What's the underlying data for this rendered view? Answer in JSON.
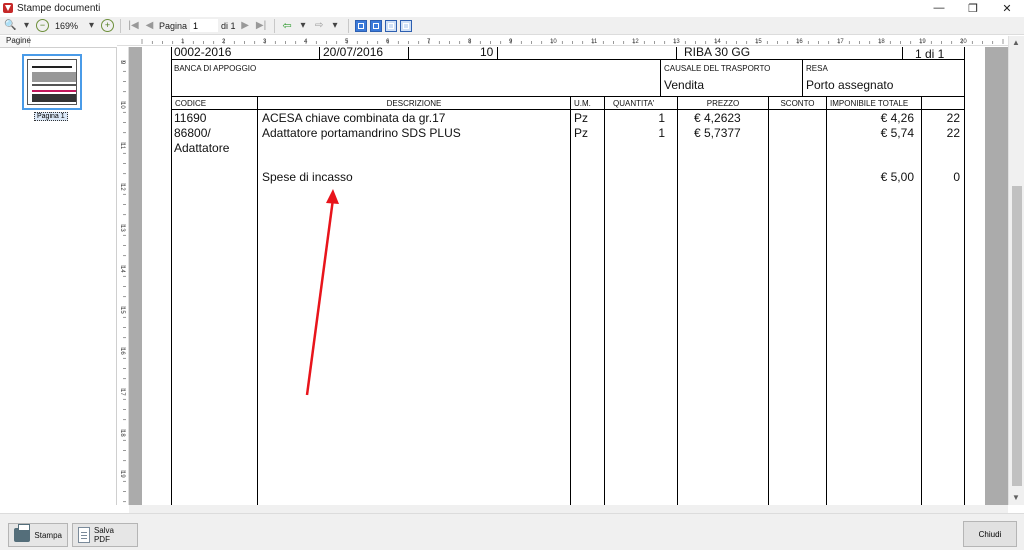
{
  "window": {
    "title": "Stampe documenti",
    "controls": {
      "minimize": "—",
      "restore": "❐",
      "close": "✕"
    }
  },
  "toolbar": {
    "zoom_value": "169%",
    "page_label": "Pagina",
    "page_number": "1",
    "page_total": "di 1"
  },
  "left_pane": {
    "tab_label": "Pagine",
    "thumbnail_label": "Pagina 1"
  },
  "ruler": {
    "horizontal": [
      "1",
      "2",
      "3",
      "4",
      "5",
      "6",
      "7",
      "8",
      "9",
      "10",
      "11",
      "12",
      "13",
      "14",
      "15",
      "16",
      "17",
      "18",
      "19",
      "20"
    ],
    "vertical": [
      "9",
      "10",
      "11",
      "12",
      "13",
      "14",
      "15",
      "16",
      "17",
      "18",
      "19"
    ]
  },
  "document": {
    "top_row": {
      "number": "0002-2016",
      "date": "20/07/2016",
      "code": "10",
      "payment": "RIBA 30 GG",
      "page": "1 di 1"
    },
    "info_row": {
      "bank_label": "BANCA DI APPOGGIO",
      "transport_label": "CAUSALE DEL TRASPORTO",
      "transport_value": "Vendita",
      "resa_label": "RESA",
      "resa_value": "Porto assegnato"
    },
    "columns": {
      "code": "CODICE",
      "description": "DESCRIZIONE",
      "um": "U.M.",
      "qty": "QUANTITA'",
      "price": "PREZZO",
      "discount": "SCONTO",
      "taxable": "IMPONIBILE TOTALE",
      "vat": ""
    },
    "rows": [
      {
        "code": "11690",
        "code2": "",
        "description": "ACESA chiave combinata da gr.17",
        "um": "Pz",
        "qty": "1",
        "price": "€ 4,2623",
        "discount": "",
        "taxable": "€ 4,26",
        "vat": "22"
      },
      {
        "code": "86800/",
        "code2": "Adattatore",
        "description": "Adattatore portamandrino SDS PLUS",
        "um": "Pz",
        "qty": "1",
        "price": "€ 5,7377",
        "discount": "",
        "taxable": "€ 5,74",
        "vat": "22"
      },
      {
        "code": "",
        "code2": "",
        "description": "Spese di incasso",
        "um": "",
        "qty": "",
        "price": "",
        "discount": "",
        "taxable": "€ 5,00",
        "vat": "0"
      }
    ]
  },
  "annotation": {
    "color": "#e8141b"
  },
  "bottom": {
    "print_label": "Stampa",
    "pdf_label": "Salva PDF",
    "close_label": "Chiudi"
  }
}
